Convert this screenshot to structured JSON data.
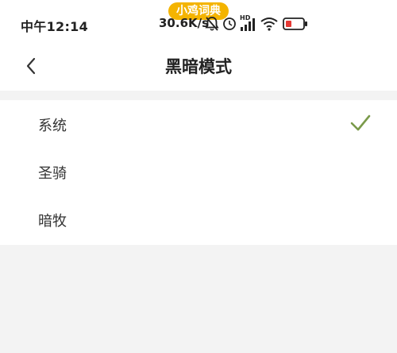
{
  "status_bar": {
    "time": "中午12:14",
    "app_pill": "小鸡词典",
    "net_speed": "30.6K/s",
    "hd_label": "HD",
    "icons": [
      "alarm-off-icon",
      "clock-icon",
      "signal-icon",
      "wifi-icon",
      "battery-icon"
    ]
  },
  "header": {
    "title": "黑暗模式",
    "back_icon": "chevron-left-icon"
  },
  "options": [
    {
      "label": "系统",
      "selected": true
    },
    {
      "label": "圣骑",
      "selected": false
    },
    {
      "label": "暗牧",
      "selected": false
    }
  ],
  "colors": {
    "check": "#7a9a4a",
    "pill": "#f4b400",
    "background": "#f3f3f3"
  }
}
